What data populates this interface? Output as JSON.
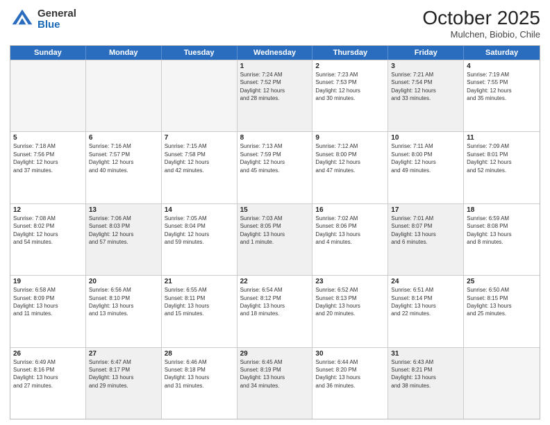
{
  "header": {
    "logo_general": "General",
    "logo_blue": "Blue",
    "month": "October 2025",
    "location": "Mulchen, Biobio, Chile"
  },
  "weekdays": [
    "Sunday",
    "Monday",
    "Tuesday",
    "Wednesday",
    "Thursday",
    "Friday",
    "Saturday"
  ],
  "rows": [
    [
      {
        "day": "",
        "lines": [],
        "empty": true
      },
      {
        "day": "",
        "lines": [],
        "empty": true
      },
      {
        "day": "",
        "lines": [],
        "empty": true
      },
      {
        "day": "1",
        "lines": [
          "Sunrise: 7:24 AM",
          "Sunset: 7:52 PM",
          "Daylight: 12 hours",
          "and 28 minutes."
        ]
      },
      {
        "day": "2",
        "lines": [
          "Sunrise: 7:23 AM",
          "Sunset: 7:53 PM",
          "Daylight: 12 hours",
          "and 30 minutes."
        ]
      },
      {
        "day": "3",
        "lines": [
          "Sunrise: 7:21 AM",
          "Sunset: 7:54 PM",
          "Daylight: 12 hours",
          "and 33 minutes."
        ]
      },
      {
        "day": "4",
        "lines": [
          "Sunrise: 7:19 AM",
          "Sunset: 7:55 PM",
          "Daylight: 12 hours",
          "and 35 minutes."
        ]
      }
    ],
    [
      {
        "day": "5",
        "lines": [
          "Sunrise: 7:18 AM",
          "Sunset: 7:56 PM",
          "Daylight: 12 hours",
          "and 37 minutes."
        ]
      },
      {
        "day": "6",
        "lines": [
          "Sunrise: 7:16 AM",
          "Sunset: 7:57 PM",
          "Daylight: 12 hours",
          "and 40 minutes."
        ]
      },
      {
        "day": "7",
        "lines": [
          "Sunrise: 7:15 AM",
          "Sunset: 7:58 PM",
          "Daylight: 12 hours",
          "and 42 minutes."
        ]
      },
      {
        "day": "8",
        "lines": [
          "Sunrise: 7:13 AM",
          "Sunset: 7:59 PM",
          "Daylight: 12 hours",
          "and 45 minutes."
        ]
      },
      {
        "day": "9",
        "lines": [
          "Sunrise: 7:12 AM",
          "Sunset: 8:00 PM",
          "Daylight: 12 hours",
          "and 47 minutes."
        ]
      },
      {
        "day": "10",
        "lines": [
          "Sunrise: 7:11 AM",
          "Sunset: 8:00 PM",
          "Daylight: 12 hours",
          "and 49 minutes."
        ]
      },
      {
        "day": "11",
        "lines": [
          "Sunrise: 7:09 AM",
          "Sunset: 8:01 PM",
          "Daylight: 12 hours",
          "and 52 minutes."
        ]
      }
    ],
    [
      {
        "day": "12",
        "lines": [
          "Sunrise: 7:08 AM",
          "Sunset: 8:02 PM",
          "Daylight: 12 hours",
          "and 54 minutes."
        ]
      },
      {
        "day": "13",
        "lines": [
          "Sunrise: 7:06 AM",
          "Sunset: 8:03 PM",
          "Daylight: 12 hours",
          "and 57 minutes."
        ]
      },
      {
        "day": "14",
        "lines": [
          "Sunrise: 7:05 AM",
          "Sunset: 8:04 PM",
          "Daylight: 12 hours",
          "and 59 minutes."
        ]
      },
      {
        "day": "15",
        "lines": [
          "Sunrise: 7:03 AM",
          "Sunset: 8:05 PM",
          "Daylight: 13 hours",
          "and 1 minute."
        ]
      },
      {
        "day": "16",
        "lines": [
          "Sunrise: 7:02 AM",
          "Sunset: 8:06 PM",
          "Daylight: 13 hours",
          "and 4 minutes."
        ]
      },
      {
        "day": "17",
        "lines": [
          "Sunrise: 7:01 AM",
          "Sunset: 8:07 PM",
          "Daylight: 13 hours",
          "and 6 minutes."
        ]
      },
      {
        "day": "18",
        "lines": [
          "Sunrise: 6:59 AM",
          "Sunset: 8:08 PM",
          "Daylight: 13 hours",
          "and 8 minutes."
        ]
      }
    ],
    [
      {
        "day": "19",
        "lines": [
          "Sunrise: 6:58 AM",
          "Sunset: 8:09 PM",
          "Daylight: 13 hours",
          "and 11 minutes."
        ]
      },
      {
        "day": "20",
        "lines": [
          "Sunrise: 6:56 AM",
          "Sunset: 8:10 PM",
          "Daylight: 13 hours",
          "and 13 minutes."
        ]
      },
      {
        "day": "21",
        "lines": [
          "Sunrise: 6:55 AM",
          "Sunset: 8:11 PM",
          "Daylight: 13 hours",
          "and 15 minutes."
        ]
      },
      {
        "day": "22",
        "lines": [
          "Sunrise: 6:54 AM",
          "Sunset: 8:12 PM",
          "Daylight: 13 hours",
          "and 18 minutes."
        ]
      },
      {
        "day": "23",
        "lines": [
          "Sunrise: 6:52 AM",
          "Sunset: 8:13 PM",
          "Daylight: 13 hours",
          "and 20 minutes."
        ]
      },
      {
        "day": "24",
        "lines": [
          "Sunrise: 6:51 AM",
          "Sunset: 8:14 PM",
          "Daylight: 13 hours",
          "and 22 minutes."
        ]
      },
      {
        "day": "25",
        "lines": [
          "Sunrise: 6:50 AM",
          "Sunset: 8:15 PM",
          "Daylight: 13 hours",
          "and 25 minutes."
        ]
      }
    ],
    [
      {
        "day": "26",
        "lines": [
          "Sunrise: 6:49 AM",
          "Sunset: 8:16 PM",
          "Daylight: 13 hours",
          "and 27 minutes."
        ]
      },
      {
        "day": "27",
        "lines": [
          "Sunrise: 6:47 AM",
          "Sunset: 8:17 PM",
          "Daylight: 13 hours",
          "and 29 minutes."
        ]
      },
      {
        "day": "28",
        "lines": [
          "Sunrise: 6:46 AM",
          "Sunset: 8:18 PM",
          "Daylight: 13 hours",
          "and 31 minutes."
        ]
      },
      {
        "day": "29",
        "lines": [
          "Sunrise: 6:45 AM",
          "Sunset: 8:19 PM",
          "Daylight: 13 hours",
          "and 34 minutes."
        ]
      },
      {
        "day": "30",
        "lines": [
          "Sunrise: 6:44 AM",
          "Sunset: 8:20 PM",
          "Daylight: 13 hours",
          "and 36 minutes."
        ]
      },
      {
        "day": "31",
        "lines": [
          "Sunrise: 6:43 AM",
          "Sunset: 8:21 PM",
          "Daylight: 13 hours",
          "and 38 minutes."
        ]
      },
      {
        "day": "",
        "lines": [],
        "empty": true
      }
    ]
  ]
}
